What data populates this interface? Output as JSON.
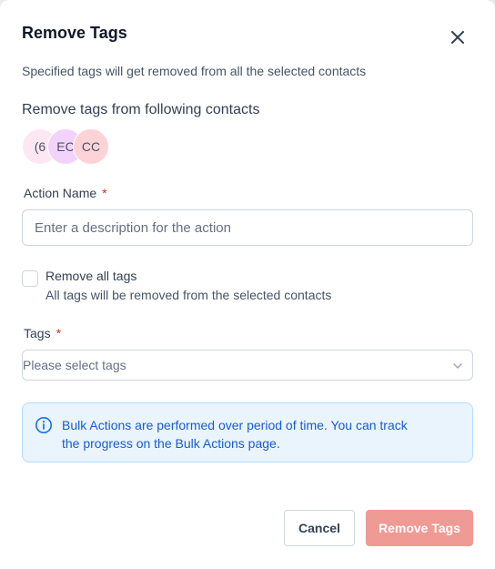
{
  "modal": {
    "title": "Remove Tags",
    "subtitle": "Specified tags will get removed from all the selected contacts",
    "contacts_label": "Remove tags from following contacts"
  },
  "avatars": [
    {
      "initials": "(6",
      "color": "#fde7f3"
    },
    {
      "initials": "EC",
      "color": "#f3d2fb"
    },
    {
      "initials": "CC",
      "color": "#fdd3d8"
    }
  ],
  "action_name": {
    "label": "Action Name",
    "required_mark": "*",
    "value": "",
    "placeholder": "Enter a description for the action"
  },
  "remove_all": {
    "label": "Remove all tags",
    "description": "All tags will be removed from the selected contacts",
    "checked": false
  },
  "tags": {
    "label": "Tags",
    "required_mark": "*",
    "placeholder": "Please select tags"
  },
  "info": {
    "text": "Bulk Actions are performed over period of time. You can track the progress on the Bulk Actions page.",
    "icon": "info-icon"
  },
  "footer": {
    "cancel_label": "Cancel",
    "submit_label": "Remove Tags"
  },
  "colors": {
    "primary_disabled": "#ef9a94",
    "info_bg": "#eaf4fd",
    "info_text": "#175cd3",
    "required": "#d92d20"
  }
}
